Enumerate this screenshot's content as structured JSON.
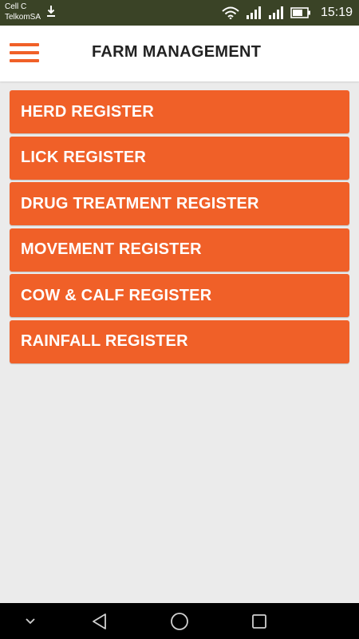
{
  "status_bar": {
    "carrier_1": "Cell C",
    "carrier_2": "TelkomSA",
    "time": "15:19",
    "icons": [
      "download-icon",
      "wifi-icon",
      "signal-icon",
      "signal-icon",
      "battery-icon"
    ]
  },
  "app_bar": {
    "title": "FARM MANAGEMENT",
    "menu_icon": "hamburger-menu-icon"
  },
  "menu": {
    "items": [
      {
        "label": "HERD REGISTER"
      },
      {
        "label": "LICK REGISTER"
      },
      {
        "label": "DRUG TREATMENT REGISTER"
      },
      {
        "label": "MOVEMENT REGISTER"
      },
      {
        "label": "COW & CALF REGISTER"
      },
      {
        "label": "RAINFALL REGISTER"
      }
    ]
  },
  "nav_bar": {
    "icons": [
      "chevron-down-icon",
      "back-icon",
      "home-icon",
      "recents-icon"
    ]
  },
  "colors": {
    "accent": "#f06028",
    "status_bar": "#3a4326",
    "background": "#ebebeb",
    "nav_bar": "#000000"
  }
}
